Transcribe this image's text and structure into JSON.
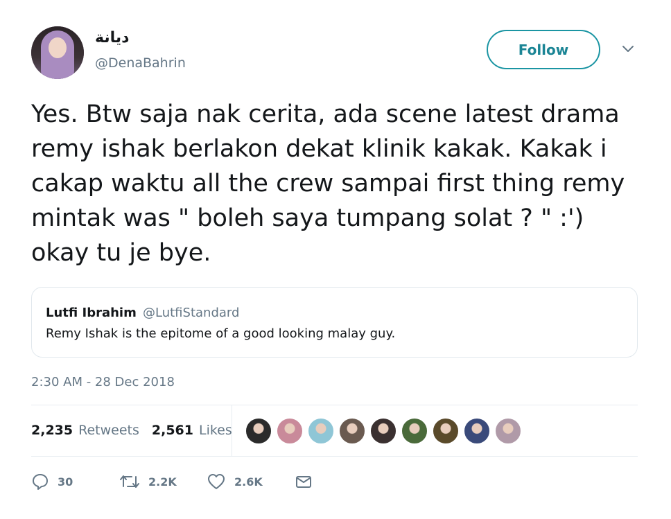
{
  "author": {
    "display_name": "ديانة",
    "handle": "@DenaBahrin"
  },
  "follow_button": {
    "label": "Follow"
  },
  "tweet": {
    "text": "Yes. Btw saja nak cerita, ada scene latest drama remy ishak berlakon dekat klinik kakak. Kakak i cakap waktu all the crew sampai first thing remy mintak was \" boleh saya tumpang solat ? \" :') okay tu je bye.",
    "timestamp": "2:30 AM - 28 Dec 2018"
  },
  "quoted_tweet": {
    "name": "Lutfi Ibrahim",
    "handle": "@LutfiStandard",
    "text": "Remy Ishak is the epitome of a good looking malay guy."
  },
  "stats": {
    "retweets_count": "2,235",
    "retweets_label": "Retweets",
    "likes_count": "2,561",
    "likes_label": "Likes"
  },
  "liker_avatars": [
    {
      "icon": "avatar-1",
      "color": "#2b2b2b"
    },
    {
      "icon": "avatar-2",
      "color": "#c98a9a"
    },
    {
      "icon": "avatar-3",
      "color": "#8fc6d6"
    },
    {
      "icon": "avatar-4",
      "color": "#6a5a50"
    },
    {
      "icon": "avatar-5",
      "color": "#3a3030"
    },
    {
      "icon": "avatar-6",
      "color": "#4a6a3a"
    },
    {
      "icon": "avatar-7",
      "color": "#5a4a2a"
    },
    {
      "icon": "avatar-8",
      "color": "#3a4a7a"
    },
    {
      "icon": "avatar-9",
      "color": "#b09aa8"
    }
  ],
  "actions": {
    "reply_count": "30",
    "retweet_count": "2.2K",
    "like_count": "2.6K"
  },
  "colors": {
    "accent": "#1b95a3",
    "secondary_text": "#657786",
    "border": "#e1e8ed"
  }
}
